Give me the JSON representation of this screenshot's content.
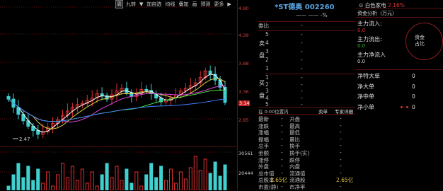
{
  "toolbar": {
    "items": [
      "周",
      "九转",
      "▼",
      "加自选",
      "均线",
      "叠加",
      "画",
      "预测",
      "更多",
      "▶"
    ]
  },
  "price_axis": [
    "4.90",
    "4.39",
    "3.88",
    "3.36",
    "3.14",
    "2.85"
  ],
  "volume_axis": [
    "30561",
    "20444"
  ],
  "low_label": "2.47",
  "header": {
    "title": "*ST德奥 002260",
    "sector": "白色家电",
    "sector_change": "2.16%",
    "dashes": "—— ——  -%"
  },
  "book": {
    "ratio_label": "委比",
    "ratio_value": "-",
    "sell_side": "卖",
    "sell_side2": "盘",
    "buy_side": "买",
    "buy_side2": "盘",
    "sell_rows": [
      "5",
      "4",
      "3",
      "2",
      "1"
    ],
    "buy_rows": [
      "1",
      "2",
      "3",
      "4",
      "5"
    ],
    "dash": "-",
    "time_label": "在 0:00位置内",
    "buy_sell_label": "卖单",
    "detail_label": "专家详细",
    "info": [
      {
        "a": "最新",
        "b": "-",
        "c": "开盘",
        "d": "-"
      },
      {
        "a": "涨跌",
        "b": "-",
        "c": "最高",
        "d": "-"
      },
      {
        "a": "涨幅",
        "b": "-",
        "c": "最低",
        "d": "-"
      },
      {
        "a": "振幅",
        "b": "-",
        "c": "量比",
        "d": "-"
      },
      {
        "a": "总手",
        "b": "-",
        "c": "换手",
        "d": "-"
      },
      {
        "a": "金额",
        "b": "-",
        "c": "换手(实)",
        "d": "-"
      },
      {
        "a": "涨停",
        "b": "-",
        "c": "跌停",
        "d": "-"
      },
      {
        "a": "外盘",
        "b": "-",
        "c": "内盘",
        "d": "-"
      },
      {
        "a": "总市值",
        "b": "-",
        "c": "流通值",
        "d": "-"
      },
      {
        "a": "总股本",
        "b": "2.65亿",
        "c": "流通股",
        "d": "2.65亿"
      },
      {
        "a": "市盈(静)",
        "b": "-",
        "c": "市净率",
        "d": "-"
      }
    ]
  },
  "fund": {
    "header": "资金分析（万元）",
    "rows": [
      {
        "label": "主力流入:",
        "value": "0.0",
        "color": "#e03030"
      },
      {
        "label": "主力流出:",
        "value": "0.0",
        "color": "#20c020"
      },
      {
        "label": "主力净流入",
        "value": "0.0",
        "color": "#ddd"
      }
    ],
    "circle_text_1": "资金",
    "circle_text_2": "占比",
    "sizes": [
      {
        "label": "净特大单",
        "value": "0"
      },
      {
        "label": "净大单",
        "value": "0"
      },
      {
        "label": "净中单",
        "value": "0"
      },
      {
        "label": "净小单",
        "value": "0"
      }
    ],
    "colors": {
      "red": "#e03030",
      "green": "#20c020",
      "blue": "#5aa8e8"
    }
  },
  "chart_data": {
    "type": "candlestick",
    "price_ticks": [
      "4.90",
      "4.39",
      "3.88",
      "3.36",
      "2.85"
    ],
    "volume_ticks": [
      "30561",
      "20444"
    ],
    "last_price": "3.14",
    "min_label": "2.47"
  }
}
